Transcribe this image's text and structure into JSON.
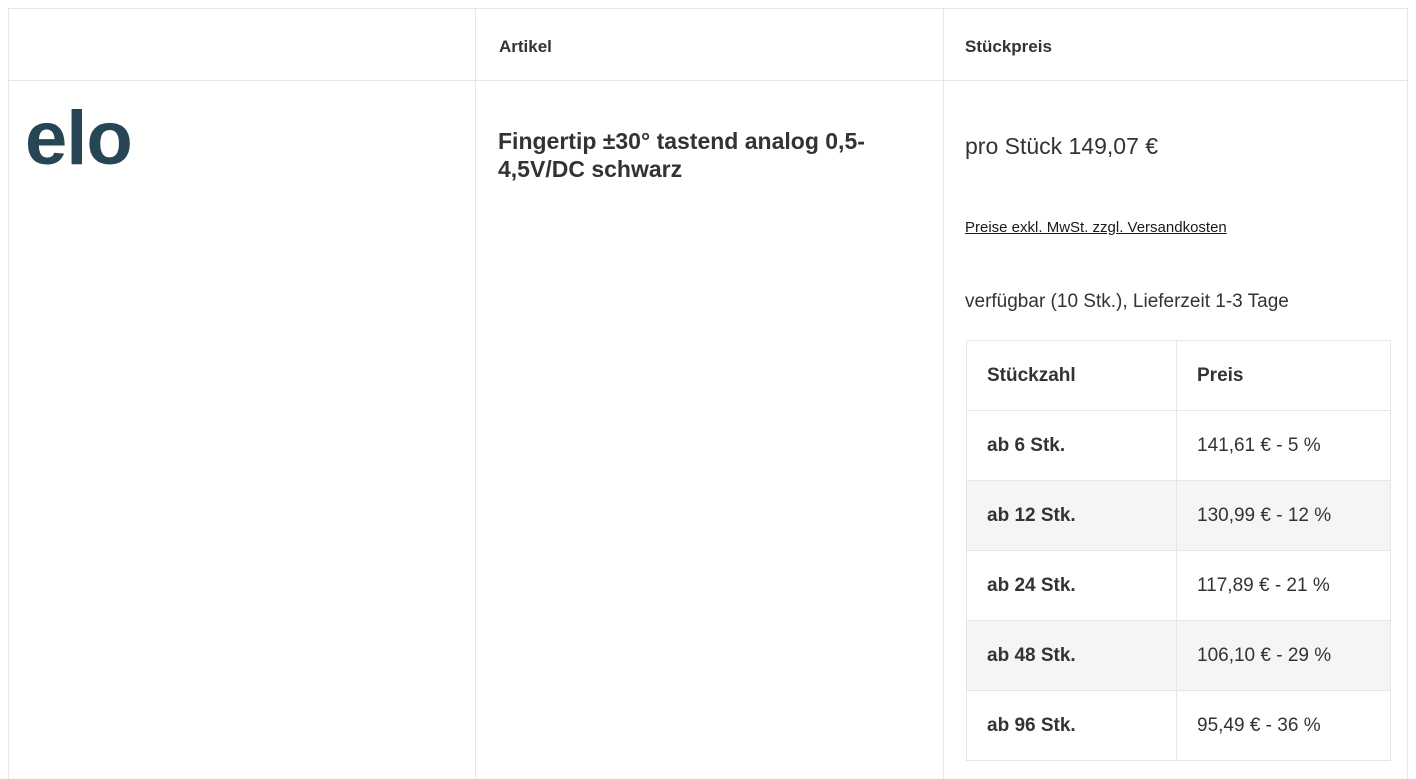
{
  "header": {
    "col_article": "Artikel",
    "col_unit_price": "Stückpreis"
  },
  "product": {
    "brand_logo_text": "elo",
    "name": "Fingertip ±30° tastend analog 0,5-4,5V/DC schwarz",
    "unit_price": "pro Stück 149,07 €",
    "tax_note": "Preise exkl. MwSt. zzgl. Versandkosten",
    "availability": "verfügbar (10 Stk.), Lieferzeit 1-3 Tage"
  },
  "tiers": {
    "headers": [
      "Stückzahl",
      "Preis"
    ],
    "rows": [
      {
        "qty": "ab 6 Stk.",
        "price": "141,61 € - 5 %"
      },
      {
        "qty": "ab 12 Stk.",
        "price": "130,99 € - 12 %"
      },
      {
        "qty": "ab 24 Stk.",
        "price": "117,89 € - 21 %"
      },
      {
        "qty": "ab 48 Stk.",
        "price": "106,10 € - 29 %"
      },
      {
        "qty": "ab 96 Stk.",
        "price": "95,49 € - 36 %"
      }
    ]
  },
  "colors": {
    "logo": "#274655",
    "border": "#e6e6e6",
    "shaded_row": "#f5f5f5"
  }
}
